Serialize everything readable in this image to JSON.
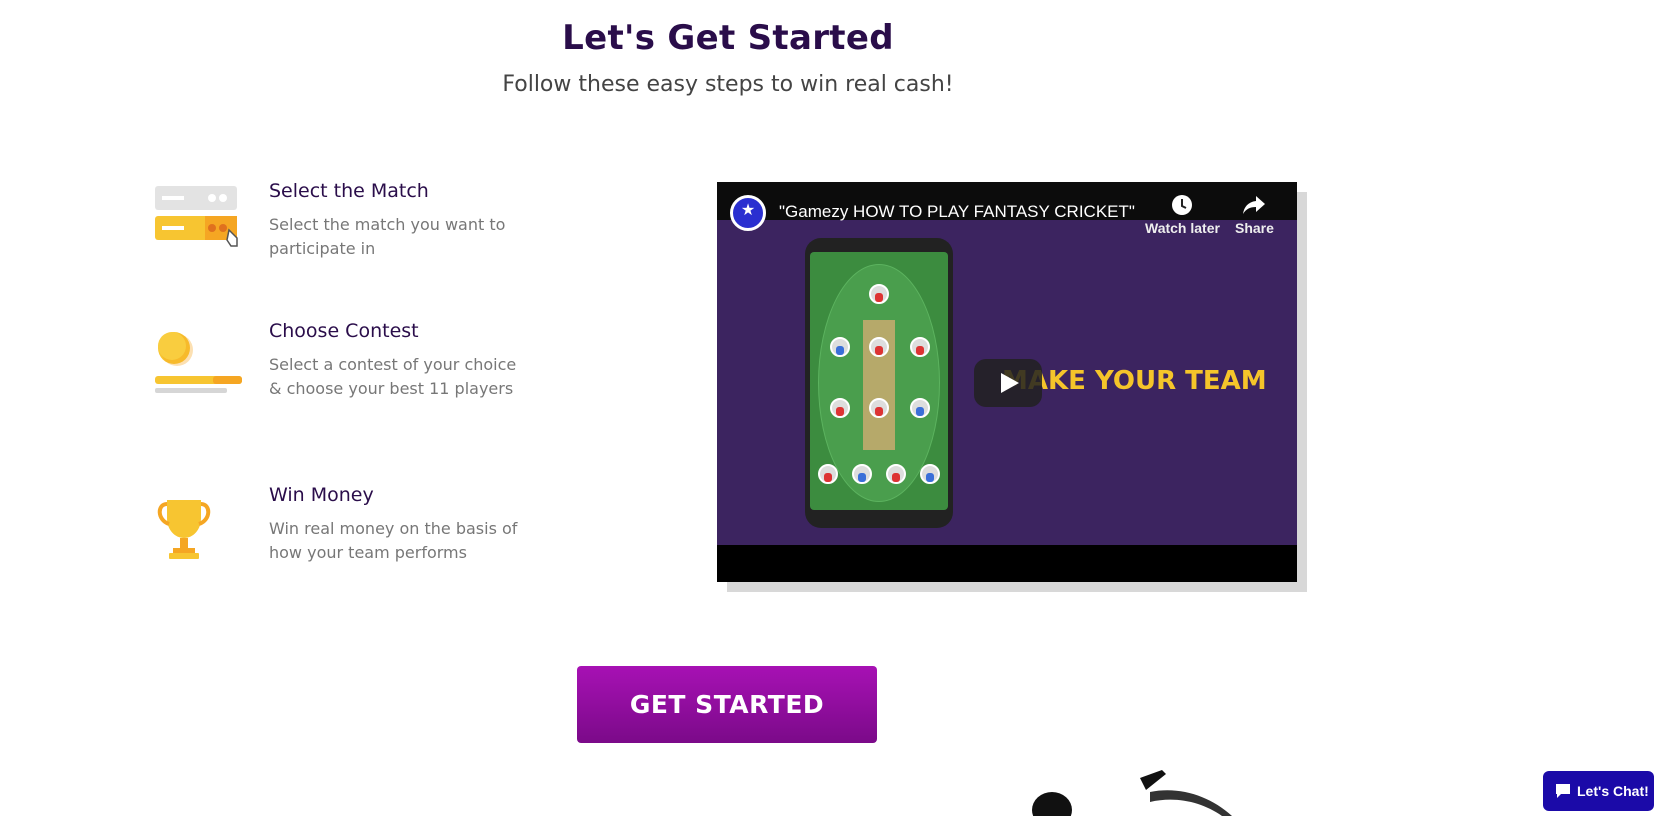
{
  "header": {
    "title": "Let's Get Started",
    "subtitle": "Follow these easy steps to win real cash!"
  },
  "steps": [
    {
      "icon": "match-cards-icon",
      "title": "Select the Match",
      "description": "Select the match you want to participate in"
    },
    {
      "icon": "coin-contest-icon",
      "title": "Choose Contest",
      "description": "Select a contest of your choice & choose your best 11 players"
    },
    {
      "icon": "trophy-icon",
      "title": "Win Money",
      "description": "Win real money on the basis of how your team performs"
    }
  ],
  "video": {
    "title": "\"Gamezy HOW TO PLAY FANTASY CRICKET\"",
    "watch_later": "Watch later",
    "share": "Share",
    "overlay_text": "MAKE YOUR TEAM"
  },
  "cta": {
    "label": "GET STARTED"
  },
  "chat": {
    "label": "Let's Chat!"
  },
  "colors": {
    "heading": "#2a0d4a",
    "cta_gradient_top": "#a711b4",
    "cta_gradient_bottom": "#7b0a89",
    "chat_bg": "#1b0aa8",
    "video_bg": "#3c2460",
    "overlay_text": "#f5c52a"
  }
}
